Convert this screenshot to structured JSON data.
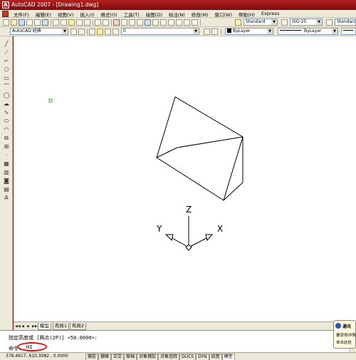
{
  "window": {
    "title": "AutoCAD 2007 - [Drawing1.dwg]",
    "app_icon": "autocad-logo-icon"
  },
  "menu": {
    "items": [
      "文件(F)",
      "编辑(E)",
      "视图(V)",
      "插入(I)",
      "格式(O)",
      "工具(T)",
      "绘图(D)",
      "标注(N)",
      "修改(M)",
      "窗口(W)",
      "帮助(H)",
      "Express"
    ]
  },
  "toolbar": {
    "text_style": "Standard",
    "dim_style": "ISO-25",
    "table_style": "Standard",
    "workspace": "AutoCAD 经典",
    "layer": "0",
    "color": "ByLayer",
    "linetype": "ByLayer"
  },
  "drawing": {
    "ucs_labels": {
      "z": "Z",
      "y": "Y",
      "x": "X"
    },
    "colors": {
      "lines": "#000000",
      "marker": "#2ea84a",
      "background": "#ffffff"
    }
  },
  "layout_tabs": {
    "tabs": [
      "模型",
      "布局1",
      "布局2"
    ],
    "active": "模型"
  },
  "command": {
    "history_line": "指定高度或 [两点(2P)] <50.0000>:",
    "prompt": "命令:",
    "input": "HI",
    "highlight_color": "#e01010"
  },
  "status": {
    "coordinates": "378.4917,  610.3082 , 0.0000",
    "modes": [
      "捕捉",
      "栅格",
      "正交",
      "极轴",
      "对象捕捉",
      "对象追踪",
      "DUCS",
      "DYN",
      "线宽",
      "模型"
    ]
  },
  "notification": {
    "title": "通讯",
    "lines": [
      "要获得详情",
      "单击此处"
    ]
  }
}
